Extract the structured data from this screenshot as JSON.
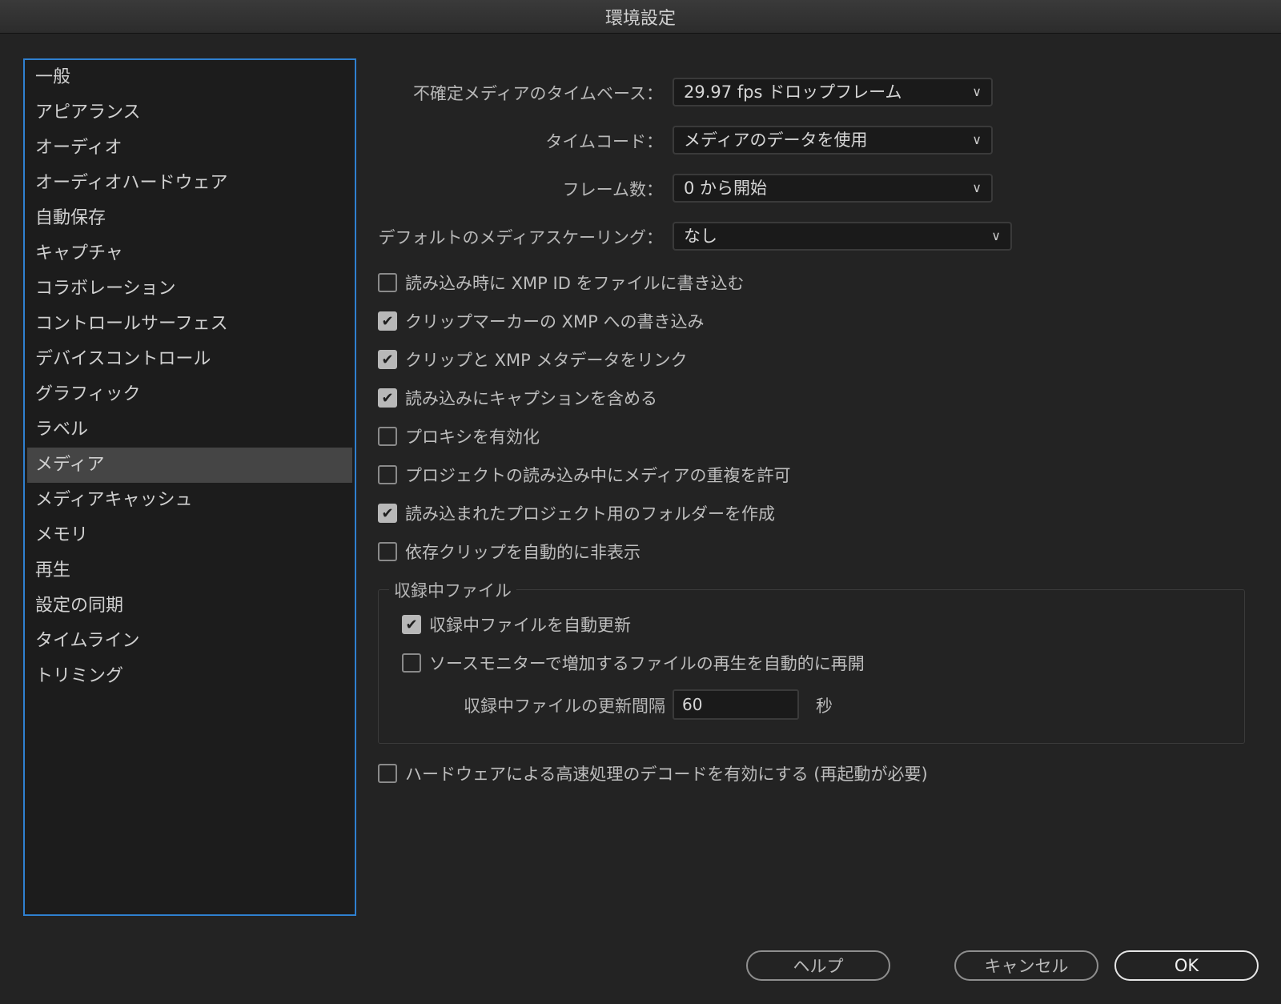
{
  "window": {
    "title": "環境設定"
  },
  "sidebar": {
    "items": [
      {
        "label": "一般"
      },
      {
        "label": "アピアランス"
      },
      {
        "label": "オーディオ"
      },
      {
        "label": "オーディオハードウェア"
      },
      {
        "label": "自動保存"
      },
      {
        "label": "キャプチャ"
      },
      {
        "label": "コラボレーション"
      },
      {
        "label": "コントロールサーフェス"
      },
      {
        "label": "デバイスコントロール"
      },
      {
        "label": "グラフィック"
      },
      {
        "label": "ラベル"
      },
      {
        "label": "メディア",
        "selected": true
      },
      {
        "label": "メディアキャッシュ"
      },
      {
        "label": "メモリ"
      },
      {
        "label": "再生"
      },
      {
        "label": "設定の同期"
      },
      {
        "label": "タイムライン"
      },
      {
        "label": "トリミング"
      }
    ]
  },
  "media": {
    "timebase": {
      "label": "不確定メディアのタイムベース：",
      "value": "29.97 fps ドロップフレーム"
    },
    "timecode": {
      "label": "タイムコード：",
      "value": "メディアのデータを使用"
    },
    "frame_count": {
      "label": "フレーム数：",
      "value": "0 から開始"
    },
    "scaling": {
      "label": "デフォルトのメディアスケーリング：",
      "value": "なし"
    },
    "checkboxes": [
      {
        "label": "読み込み時に XMP ID をファイルに書き込む",
        "checked": false
      },
      {
        "label": "クリップマーカーの XMP への書き込み",
        "checked": true
      },
      {
        "label": "クリップと XMP メタデータをリンク",
        "checked": true
      },
      {
        "label": "読み込みにキャプションを含める",
        "checked": true
      },
      {
        "label": "プロキシを有効化",
        "checked": false
      },
      {
        "label": "プロジェクトの読み込み中にメディアの重複を許可",
        "checked": false
      },
      {
        "label": "読み込まれたプロジェクト用のフォルダーを作成",
        "checked": true
      },
      {
        "label": "依存クリップを自動的に非表示",
        "checked": false
      }
    ],
    "growing_files": {
      "legend": "収録中ファイル",
      "auto_refresh": {
        "label": "収録中ファイルを自動更新",
        "checked": true
      },
      "resume_playback": {
        "label": "ソースモニターで増加するファイルの再生を自動的に再開",
        "checked": false
      },
      "interval_label": "収録中ファイルの更新間隔",
      "interval_value": "60",
      "interval_unit": "秒"
    },
    "hw_decode": {
      "label": "ハードウェアによる高速処理のデコードを有効にする (再起動が必要)",
      "checked": false
    }
  },
  "buttons": {
    "help": "ヘルプ",
    "cancel": "キャンセル",
    "ok": "OK"
  }
}
